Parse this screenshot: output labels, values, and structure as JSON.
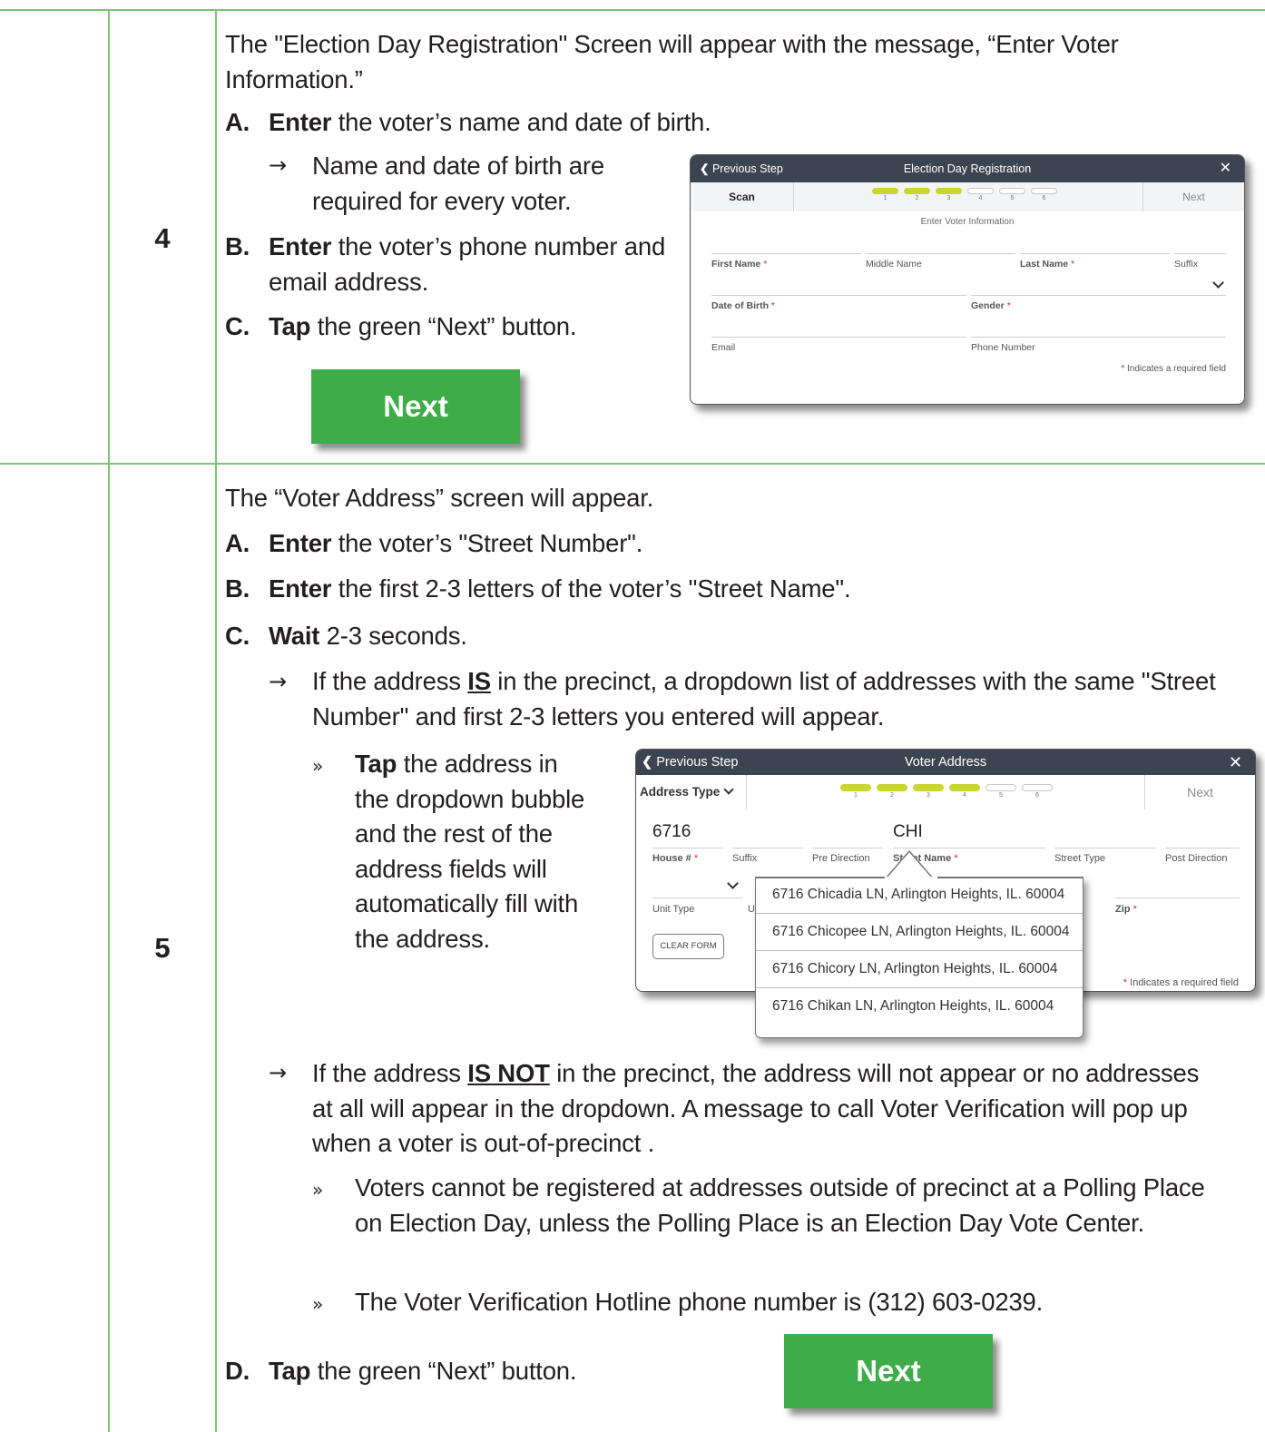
{
  "steps": [
    {
      "number": "4",
      "intro": "The \"Election Day Registration\" Screen will appear with the message, “Enter Voter Information.”",
      "items": [
        {
          "letter": "A.",
          "verb": "Enter",
          "text": " the voter’s name and date of birth."
        },
        {
          "letter": "B.",
          "verb": "Enter",
          "text": " the voter’s phone number and email address."
        },
        {
          "letter": "C.",
          "verb": "Tap",
          "text": " the green “Next” button."
        }
      ],
      "arrow_note": "Name and date of birth are required for every voter.",
      "next_button": "Next"
    },
    {
      "number": "5",
      "intro": "The “Voter Address” screen will appear.",
      "items": [
        {
          "letter": "A.",
          "verb": "Enter",
          "text": " the voter’s \"Street Number\"."
        },
        {
          "letter": "B.",
          "verb": "Enter",
          "text": " the first 2-3 letters of the voter’s \"Street Name\"."
        },
        {
          "letter": "C.",
          "verb": "Wait",
          "text": " 2-3 seconds."
        },
        {
          "letter": "D.",
          "verb": "Tap",
          "text": " the green “Next” button."
        }
      ],
      "arrow_is": {
        "pre": "If the address ",
        "em": "IS",
        "post": " in the precinct, a dropdown list of addresses with the same \"Street Number\" and first 2-3 letters you entered will appear."
      },
      "tap_bullet": {
        "verb": "Tap",
        "text": " the address in the dropdown bubble and the rest of the address fields will automatically fill with the address."
      },
      "arrow_is_not": {
        "pre": "If the address ",
        "em": "IS NOT",
        "post": " in the precinct, the address will not appear or no addresses at all will appear in the dropdown.  A message to call Voter Verification will pop up when a voter is out-of-precinct ."
      },
      "bullets": [
        "Voters cannot be registered at addresses outside of precinct at a Polling Place on Election Day, unless the Polling Place is an Election Day Vote Center.",
        "The Voter Verification Hotline phone number is (312) 603-0239."
      ],
      "next_button": "Next"
    }
  ],
  "edr_screen": {
    "prev": "Previous Step",
    "title": "Election Day Registration",
    "close": "✕",
    "scan": "Scan",
    "next": "Next",
    "steps": [
      "1",
      "2",
      "3",
      "4",
      "5",
      "6"
    ],
    "active_steps": 3,
    "subtitle": "Enter Voter Information",
    "labels": {
      "first": "First Name",
      "middle": "Middle Name",
      "last": "Last Name",
      "suffix": "Suffix",
      "dob": "Date of Birth",
      "gender": "Gender",
      "email": "Email",
      "phone": "Phone Number"
    },
    "required_mark": "*",
    "required_note": "Indicates a required field"
  },
  "addr_screen": {
    "prev": "Previous Step",
    "title": "Voter Address",
    "close": "✕",
    "address_type": "Address Type",
    "next": "Next",
    "steps": [
      "1",
      "2",
      "3",
      "4",
      "5",
      "6"
    ],
    "active_steps": 4,
    "house_value": "6716",
    "street_value": "CHI",
    "labels": {
      "house": "House #",
      "suffix": "Suffix",
      "pre_dir": "Pre Direction",
      "street_name": "Street Name",
      "street_type": "Street Type",
      "post_dir": "Post Direction",
      "unit_type": "Unit Type",
      "unit": "U",
      "zip": "Zip"
    },
    "clear_form": "CLEAR FORM",
    "required_mark": "*",
    "required_note": "Indicates a required field",
    "suggestions": [
      "6716 Chicadia LN, Arlington Heights, IL. 60004",
      "6716 Chicopee LN, Arlington Heights, IL. 60004",
      "6716 Chicory LN, Arlington Heights, IL. 60004",
      "6716 Chikan LN, Arlington Heights, IL. 60004"
    ]
  }
}
